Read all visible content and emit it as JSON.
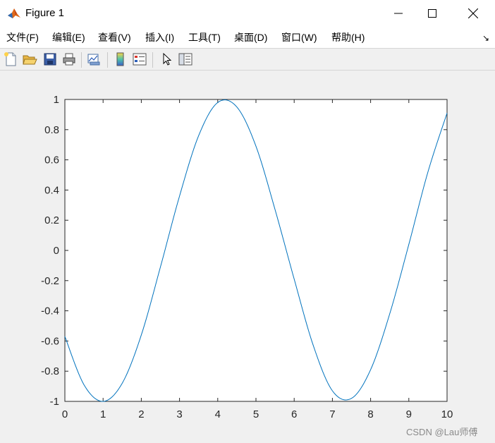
{
  "window": {
    "title": "Figure 1",
    "icon": "matlab-logo-icon"
  },
  "menu": {
    "items": [
      "文件(F)",
      "编辑(E)",
      "查看(V)",
      "插入(I)",
      "工具(T)",
      "桌面(D)",
      "窗口(W)",
      "帮助(H)"
    ],
    "dock_glyph": "↘"
  },
  "toolbar": {
    "buttons": [
      "new-figure-icon",
      "open-file-icon",
      "save-icon",
      "print-icon",
      "link-plot-icon",
      "colorbar-icon",
      "legend-icon",
      "pointer-icon",
      "property-editor-icon"
    ]
  },
  "chart_data": {
    "type": "line",
    "title": "",
    "xlabel": "",
    "ylabel": "",
    "xlim": [
      0,
      10
    ],
    "ylim": [
      -1,
      1
    ],
    "xticks": [
      "0",
      "1",
      "2",
      "3",
      "4",
      "5",
      "6",
      "7",
      "8",
      "9",
      "10"
    ],
    "yticks": [
      "-1",
      "-0.8",
      "-0.6",
      "-0.4",
      "-0.2",
      "0",
      "0.2",
      "0.4",
      "0.6",
      "0.8",
      "1"
    ],
    "grid": false,
    "series": [
      {
        "color": "#0072bd",
        "x": [
          0,
          0.5,
          1,
          1.5,
          2,
          2.5,
          3,
          3.5,
          4,
          4.5,
          5,
          5.5,
          6,
          6.5,
          7,
          7.5,
          8,
          8.5,
          9,
          9.5,
          10
        ],
        "y": [
          -0.57,
          -0.89,
          -1.0,
          -0.88,
          -0.56,
          -0.11,
          0.36,
          0.76,
          0.98,
          0.95,
          0.69,
          0.27,
          -0.19,
          -0.63,
          -0.93,
          -0.98,
          -0.79,
          -0.42,
          0.04,
          0.52,
          0.91
        ]
      }
    ]
  },
  "watermark": "CSDN @Lau师傅"
}
